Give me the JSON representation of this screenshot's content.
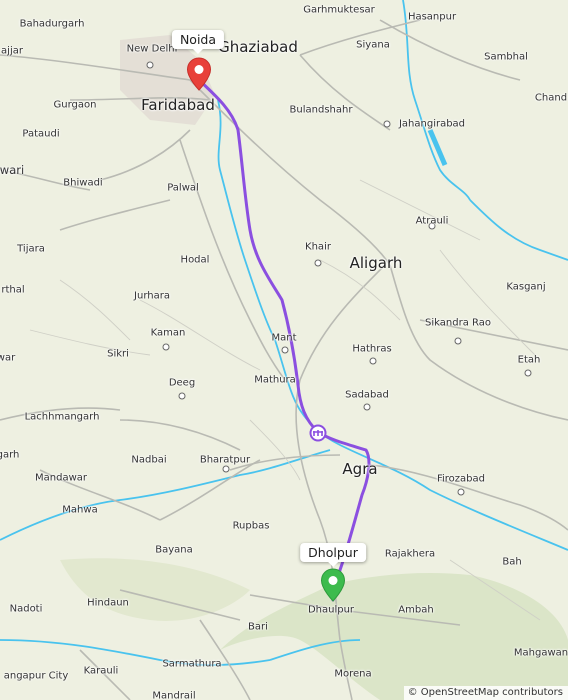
{
  "map": {
    "route_color": "#8b4fe0",
    "start_pin_color": "#e8403a",
    "end_pin_color": "#3dbb4d",
    "toll_icon": "toll-gate-icon",
    "attribution": "© OpenStreetMap contributors",
    "route_tags": {
      "start": "Noida",
      "end": "Dholpur"
    },
    "places": {
      "bahadurgarh": "Bahadurgarh",
      "new_delhi": "New Delhi",
      "ghaziabad": "Ghaziabad",
      "garhmuktesar": "Garhmuktesar",
      "hasanpur": "Hasanpur",
      "jhajjar": "ajjar",
      "siyana": "Siyana",
      "sambhal": "Sambhal",
      "chandausi": "Chand",
      "gurgaon": "Gurgaon",
      "faridabad": "Faridabad",
      "bulandshahr": "Bulandshahr",
      "jahangirabad": "Jahangirabad",
      "pataudi": "Pataudi",
      "rewari": "wari",
      "bhiwadi": "Bhiwadi",
      "palwal": "Palwal",
      "atrauli": "Atrauli",
      "tijara": "Tijara",
      "hodal": "Hodal",
      "khair": "Khair",
      "aligarh": "Aligarh",
      "kasganj": "Kasganj",
      "tapukara": "rthal",
      "jurhara": "Jurhara",
      "sikandra_rao": "Sikandra Rao",
      "kaman": "Kaman",
      "mant": "Mant",
      "hathras": "Hathras",
      "etah": "Etah",
      "alwar": "war",
      "sikri": "Sikri",
      "deeg": "Deeg",
      "mathura": "Mathura",
      "sadabad": "Sadabad",
      "lachhmangarh": "Lachhmangarh",
      "rajgarh": "garh",
      "nadbai": "Nadbai",
      "bharatpur": "Bharatpur",
      "agra": "Agra",
      "firozabad": "Firozabad",
      "mandawar": "Mandawar",
      "mahwa": "Mahwa",
      "etawah_edge": "",
      "rupbas": "Rupbas",
      "rajakhera": "Rajakhera",
      "bayana": "Bayana",
      "bah": "Bah",
      "dholpur": "Dhaulpur",
      "nadoti": "Nadoti",
      "hindaun": "Hindaun",
      "ambah": "Ambah",
      "bari": "Bari",
      "mahgawan": "Mahgawan",
      "karauli": "Karauli",
      "gangapur": "angapur City",
      "sarmathura": "Sarmathura",
      "mandrail": "Mandrail",
      "morena": "Morena"
    }
  }
}
